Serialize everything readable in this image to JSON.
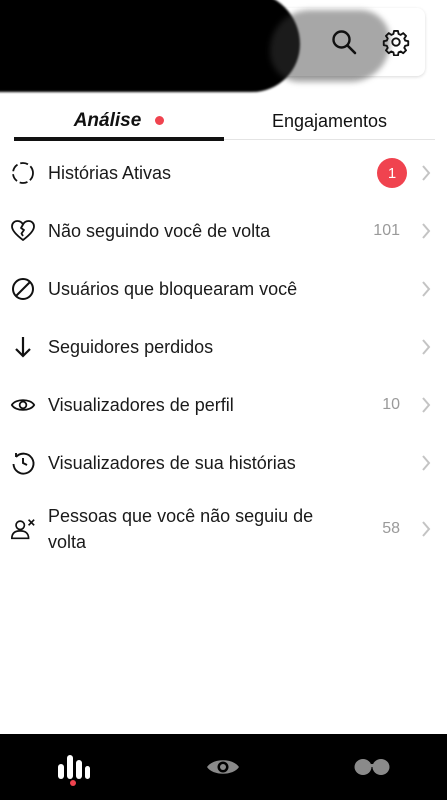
{
  "header": {
    "search_icon": "search-icon",
    "settings_icon": "gear-icon"
  },
  "tabs": [
    {
      "label": "Análise",
      "active": true,
      "has_dot": true
    },
    {
      "label": "Engajamentos",
      "active": false
    }
  ],
  "list": [
    {
      "icon": "dashed-circle-icon",
      "label": "Histórias Ativas",
      "badge": "1"
    },
    {
      "icon": "broken-heart-icon",
      "label": "Não seguindo você de volta",
      "count": "101"
    },
    {
      "icon": "block-icon",
      "label": "Usuários que bloquearam você"
    },
    {
      "icon": "arrow-down-icon",
      "label": "Seguidores perdidos"
    },
    {
      "icon": "eye-icon",
      "label": "Visualizadores de perfil",
      "count": "10"
    },
    {
      "icon": "story-clock-icon",
      "label": "Visualizadores de sua histórias"
    },
    {
      "icon": "user-x-icon",
      "label": "Pessoas que você não seguiu de volta",
      "count": "58"
    }
  ],
  "bottom_nav": [
    {
      "icon": "stats-icon",
      "active": true
    },
    {
      "icon": "eye-icon",
      "active": false
    },
    {
      "icon": "glasses-icon",
      "active": false
    }
  ],
  "colors": {
    "accent": "#f0434f",
    "nav_bg": "#000000",
    "muted": "#9a9a9a"
  }
}
